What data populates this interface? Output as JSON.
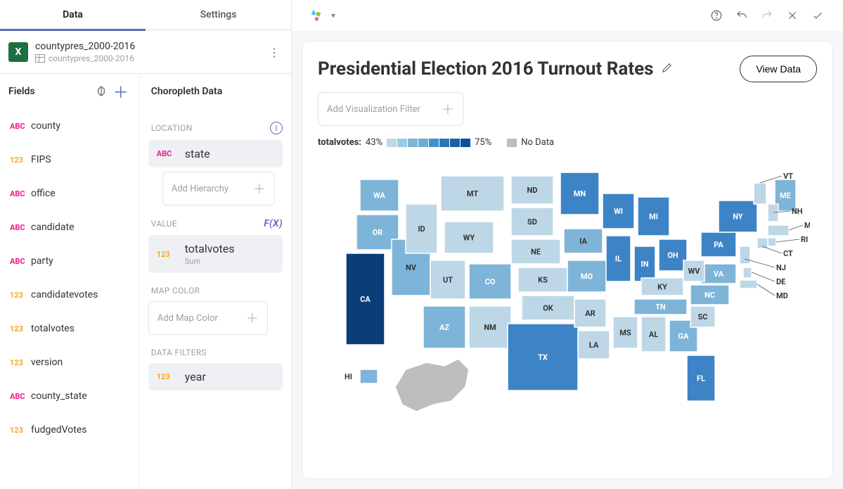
{
  "tabs": {
    "data": "Data",
    "settings": "Settings",
    "active": "data"
  },
  "datasource": {
    "title": "countypres_2000-2016",
    "subtitle": "countypres_2000-2016"
  },
  "fields": {
    "header": "Fields",
    "items": [
      {
        "type": "abc",
        "typeLabel": "ABC",
        "name": "county"
      },
      {
        "type": "num",
        "typeLabel": "123",
        "name": "FIPS"
      },
      {
        "type": "abc",
        "typeLabel": "ABC",
        "name": "office"
      },
      {
        "type": "abc",
        "typeLabel": "ABC",
        "name": "candidate"
      },
      {
        "type": "abc",
        "typeLabel": "ABC",
        "name": "party"
      },
      {
        "type": "num",
        "typeLabel": "123",
        "name": "candidatevotes"
      },
      {
        "type": "num",
        "typeLabel": "123",
        "name": "totalvotes"
      },
      {
        "type": "num",
        "typeLabel": "123",
        "name": "version"
      },
      {
        "type": "abc",
        "typeLabel": "ABC",
        "name": "county_state"
      },
      {
        "type": "num",
        "typeLabel": "123",
        "name": "fudgedVotes"
      }
    ]
  },
  "choropleth": {
    "header": "Choropleth Data",
    "location": {
      "label": "LOCATION",
      "pill": {
        "typeLabel": "ABC",
        "name": "state"
      },
      "placeholder": "Add Hierarchy"
    },
    "value": {
      "label": "VALUE",
      "fx": "F(x)",
      "pill": {
        "typeLabel": "123",
        "name": "totalvotes",
        "agg": "Sum"
      }
    },
    "mapcolor": {
      "label": "MAP COLOR",
      "placeholder": "Add Map Color"
    },
    "datafilters": {
      "label": "DATA FILTERS",
      "pill": {
        "typeLabel": "123",
        "name": "year"
      }
    }
  },
  "viz": {
    "title": "Presidential Election 2016 Turnout Rates",
    "viewData": "View Data",
    "filterPlaceholder": "Add Visualization Filter",
    "legend": {
      "field": "totalvotes:",
      "min": "43%",
      "max": "75%",
      "nodata": "No Data",
      "colors": [
        "#bdd7e7",
        "#9ecae1",
        "#7eb4d8",
        "#6baed6",
        "#4292c6",
        "#2879b9",
        "#1d60a8",
        "#08519c"
      ]
    }
  }
}
